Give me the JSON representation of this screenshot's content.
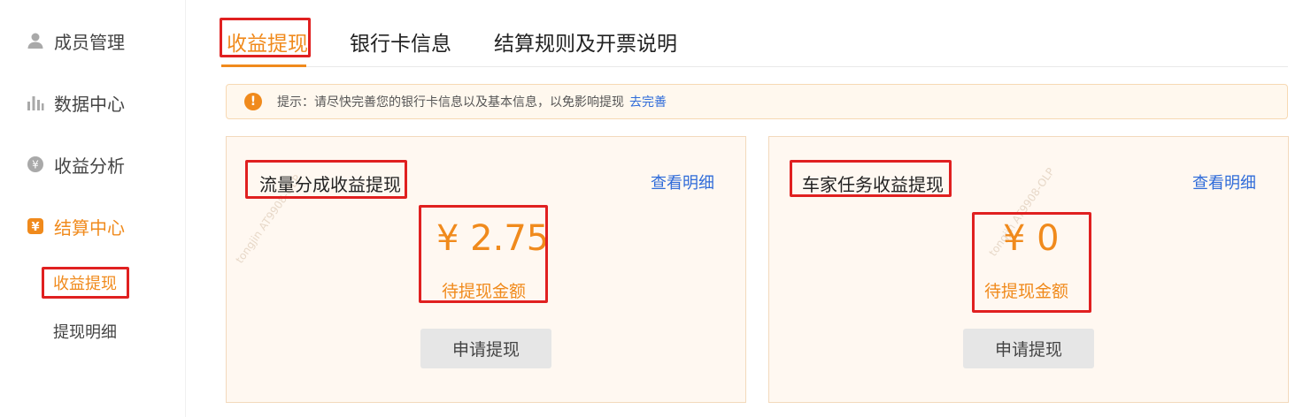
{
  "sidebar": {
    "items": [
      {
        "label": "成员管理",
        "icon": "user-icon"
      },
      {
        "label": "数据中心",
        "icon": "bar-chart-icon"
      },
      {
        "label": "收益分析",
        "icon": "yen-circle-icon"
      },
      {
        "label": "结算中心",
        "icon": "yen-square-icon",
        "active": true
      }
    ],
    "subitems": [
      {
        "label": "收益提现",
        "active": true
      },
      {
        "label": "提现明细"
      }
    ]
  },
  "tabs": [
    {
      "label": "收益提现",
      "active": true
    },
    {
      "label": "银行卡信息"
    },
    {
      "label": "结算规则及开票说明"
    }
  ],
  "notice": {
    "text": "提示：请尽快完善您的银行卡信息以及基本信息，以免影响提现",
    "link": "去完善"
  },
  "cards": [
    {
      "title": "流量分成收益提现",
      "link": "查看明细",
      "amount": "¥ 2.75",
      "amount_label": "待提现金额",
      "button": "申请提现"
    },
    {
      "title": "车家任务收益提现",
      "link": "查看明细",
      "amount": "¥ 0",
      "amount_label": "待提现金额",
      "button": "申请提现"
    }
  ],
  "colors": {
    "accent": "#f08a1c",
    "link": "#2f6bd9",
    "highlight_box": "#e02020",
    "card_bg": "#fff8f1"
  }
}
